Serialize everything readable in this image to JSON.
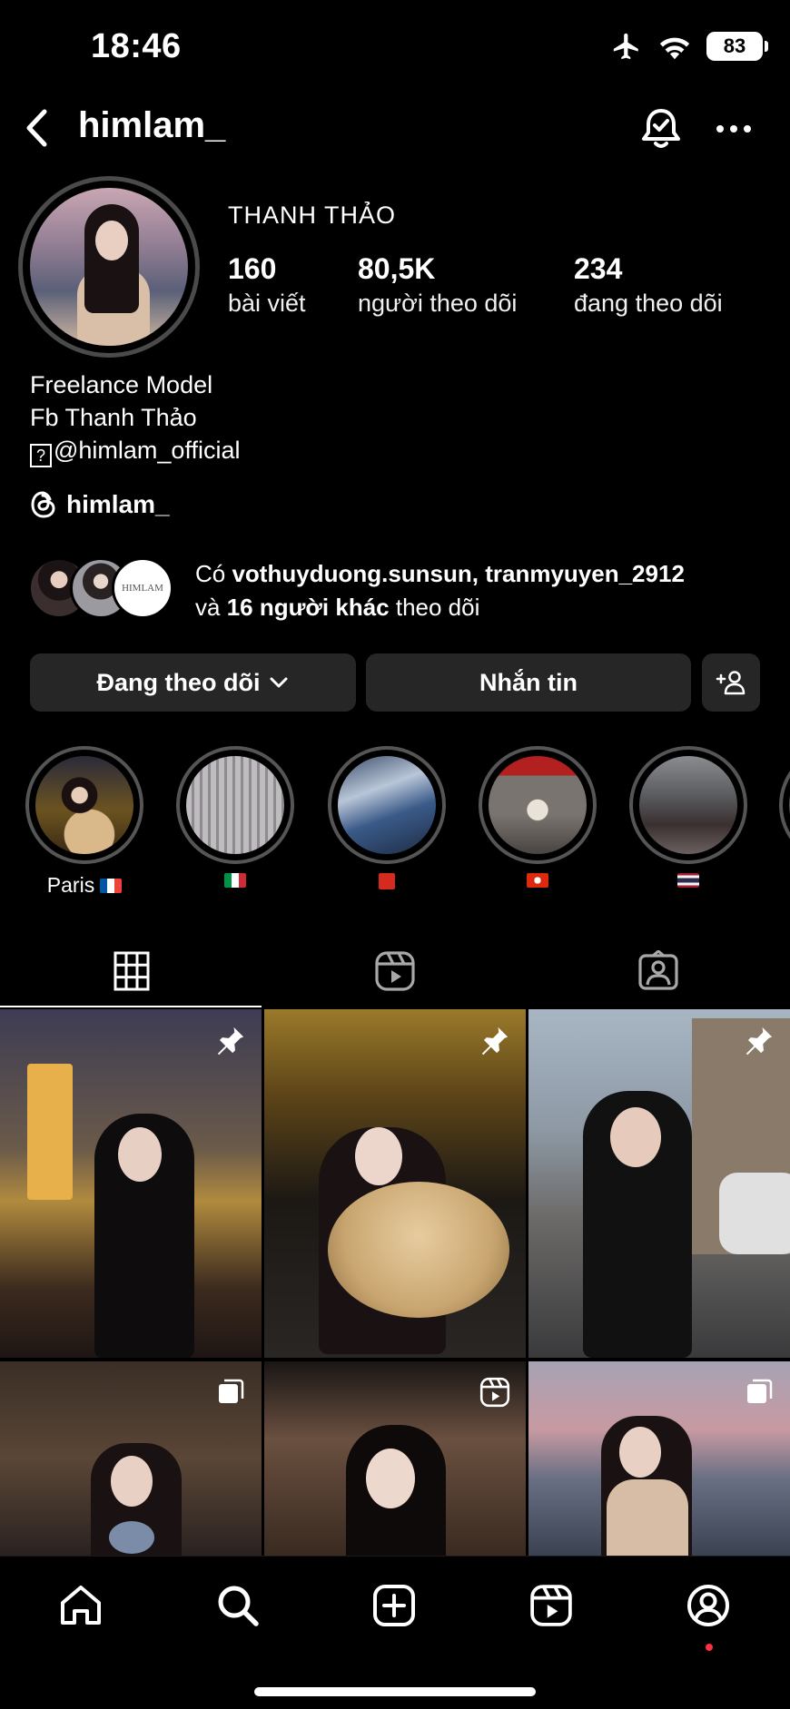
{
  "status_bar": {
    "time": "18:46",
    "battery": "83"
  },
  "header": {
    "username": "himlam_"
  },
  "profile": {
    "display_name": "THANH THẢO",
    "stats": [
      {
        "value": "160",
        "label": "bài viết"
      },
      {
        "value": "80,5K",
        "label": "người theo dõi"
      },
      {
        "value": "234",
        "label": "đang theo dõi"
      }
    ],
    "bio": {
      "line1": "Freelance Model",
      "line2": "Fb Thanh Thảo",
      "line3_box": "?",
      "line3": "@himlam_official"
    },
    "threads": "himlam_",
    "mutual": {
      "prefix": "Có ",
      "names": "vothuyduong.sunsun, tranmyuyen_2912",
      "and": "và ",
      "others": "16 người khác",
      "suffix": " theo dõi",
      "third_avatar_text": "HIMLAM"
    }
  },
  "buttons": {
    "following": "Đang theo dõi",
    "message": "Nhắn tin"
  },
  "highlights": [
    {
      "label": "Paris",
      "flag": "france"
    },
    {
      "label": "",
      "flag": "italy"
    },
    {
      "label": "",
      "flag": "switzerland"
    },
    {
      "label": "",
      "flag": "hong-kong"
    },
    {
      "label": "",
      "flag": "thailand"
    }
  ],
  "tabs": [
    "grid",
    "reels",
    "tagged"
  ],
  "posts": [
    {
      "badge": "pin-icon"
    },
    {
      "badge": "pin-icon"
    },
    {
      "badge": "pin-icon"
    },
    {
      "badge": "carousel-icon"
    },
    {
      "badge": "reels-icon"
    },
    {
      "badge": "carousel-icon"
    }
  ],
  "bottom_nav": [
    "home-icon",
    "search-icon",
    "create-icon",
    "reels-icon",
    "profile-icon"
  ]
}
